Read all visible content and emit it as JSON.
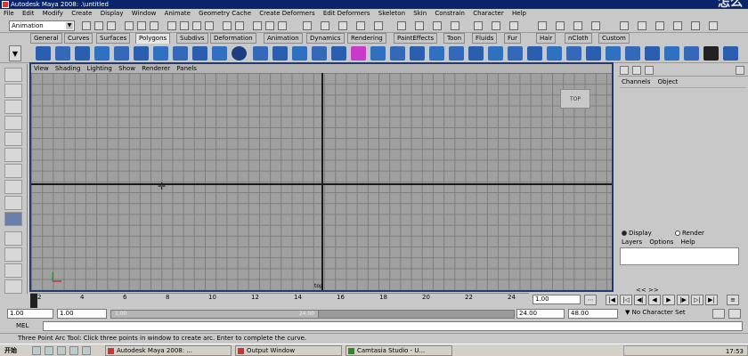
{
  "window": {
    "title": "Autodesk Maya 2008: .\\untitled",
    "watermark": "怎么"
  },
  "menubar": {
    "items": [
      "File",
      "Edit",
      "Modify",
      "Create",
      "Display",
      "Window",
      "Animate",
      "Geometry Cache",
      "Create Deformers",
      "Edit Deformers",
      "Skeleton",
      "Skin",
      "Constrain",
      "Character",
      "Help"
    ]
  },
  "statusline": {
    "mode": "Animation"
  },
  "shelf_tabs": [
    "General",
    "Curves",
    "Surfaces",
    "Polygons",
    "Subdivs",
    "Deformation",
    "Animation",
    "Dynamics",
    "Rendering",
    "PaintEffects",
    "Toon",
    "Fluids",
    "Fur",
    "Hair",
    "nCloth",
    "Custom"
  ],
  "active_shelf_tab": "Polygons",
  "viewport": {
    "menu": [
      "View",
      "Shading",
      "Lighting",
      "Show",
      "Renderer",
      "Panels"
    ],
    "viewcube_label": "TOP",
    "camera_label": "top"
  },
  "channel_box": {
    "menu": [
      "Channels",
      "Object"
    ],
    "radio_display": "Display",
    "radio_render": "Render",
    "layer_menu": [
      "Layers",
      "Options",
      "Help"
    ],
    "nav": "<<   >>"
  },
  "time_slider": {
    "ticks": [
      "2",
      "4",
      "6",
      "8",
      "10",
      "12",
      "14",
      "16",
      "18",
      "20",
      "22",
      "24"
    ],
    "current_frame": "1.00"
  },
  "range_slider": {
    "start_time": "1.00",
    "playback_start": "1.00",
    "range_start_label": "1.00",
    "range_end_label": "24.00",
    "playback_end": "24.00",
    "end_time": "48.00",
    "character_set": "No Character Set"
  },
  "command_line": {
    "label": "MEL"
  },
  "help_line": {
    "text": "Three Point Arc Tool: Click three points in window to create arc. Enter to complete the curve."
  },
  "taskbar": {
    "start": "开始",
    "tasks": [
      "Autodesk Maya 2008: ...",
      "Output Window",
      "Camtasia Studio - U..."
    ],
    "clock": "17:53"
  },
  "colors": {
    "viewport_border": "#233a6e",
    "titlebar": "#0a246a",
    "grid": "#7e7e7e",
    "viewport_bg": "#a0a0a0"
  }
}
